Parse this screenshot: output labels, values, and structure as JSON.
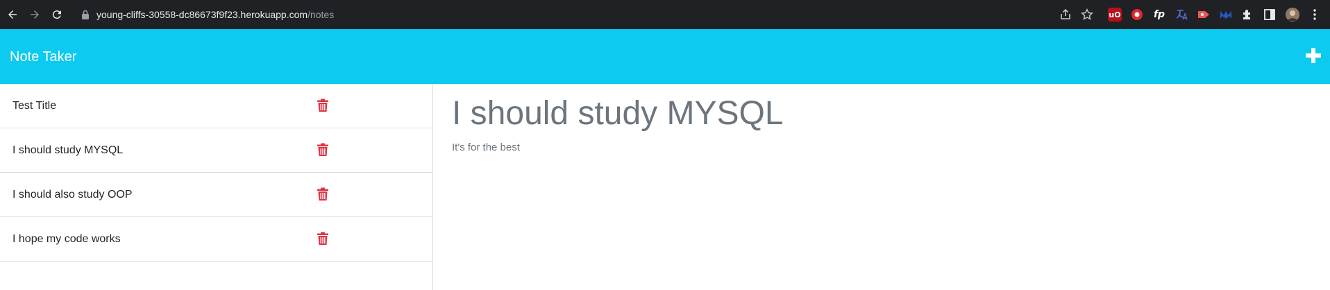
{
  "browser": {
    "url_host": "young-cliffs-30558-dc86673f9f23.herokuapp.com",
    "url_path": "/notes",
    "extension_labels": [
      "uO",
      "fp"
    ]
  },
  "app": {
    "title": "Note Taker",
    "add_icon": "plus-icon"
  },
  "notes": [
    {
      "title": "Test Title"
    },
    {
      "title": "I should study MYSQL"
    },
    {
      "title": "I should also study OOP"
    },
    {
      "title": "I hope my code works"
    }
  ],
  "active_note": {
    "title": "I should study MYSQL",
    "text": "It's for the best"
  },
  "colors": {
    "header": "#0dcaf0",
    "delete": "#dc3545",
    "chrome_bg": "#202124"
  }
}
